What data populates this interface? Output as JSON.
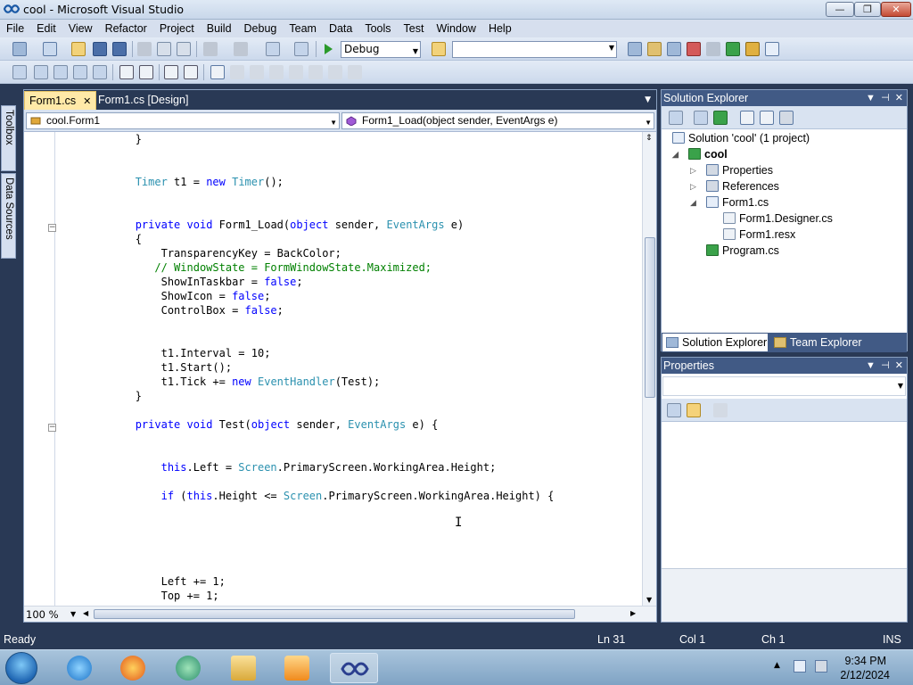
{
  "window": {
    "title": "cool - Microsoft Visual Studio",
    "min": "—",
    "max": "❐",
    "close": "✕"
  },
  "menu": [
    "File",
    "Edit",
    "View",
    "Refactor",
    "Project",
    "Build",
    "Debug",
    "Team",
    "Data",
    "Tools",
    "Test",
    "Window",
    "Help"
  ],
  "toolbar": {
    "configuration": "Debug",
    "platform": ""
  },
  "left_tabs": {
    "toolbox": "Toolbox",
    "data_sources": "Data Sources"
  },
  "editor": {
    "tabs": [
      {
        "label": "Form1.cs",
        "active": true
      },
      {
        "label": "Form1.cs [Design]",
        "active": false
      }
    ],
    "close_glyph": "✕",
    "nav_class": "cool.Form1",
    "nav_member": "Form1_Load(object sender, EventArgs e)",
    "zoom": "100 %",
    "code_lines": [
      {
        "t": "            }",
        "cls": ""
      },
      {
        "t": "",
        "cls": ""
      },
      {
        "t": "",
        "cls": ""
      },
      {
        "t": "            Timer t1 = new Timer();",
        "cls": "timer"
      },
      {
        "t": "",
        "cls": ""
      },
      {
        "t": "",
        "cls": ""
      },
      {
        "t": "            private void Form1_Load(object sender, EventArgs e)",
        "cls": "load"
      },
      {
        "t": "            {",
        "cls": ""
      },
      {
        "t": "                TransparencyKey = BackColor;",
        "cls": ""
      },
      {
        "t": "               // WindowState = FormWindowState.Maximized;",
        "cls": "cm"
      },
      {
        "t": "                ShowInTaskbar = false;",
        "cls": "false"
      },
      {
        "t": "                ShowIcon = false;",
        "cls": "false"
      },
      {
        "t": "                ControlBox = false;",
        "cls": "false"
      },
      {
        "t": "",
        "cls": ""
      },
      {
        "t": "",
        "cls": ""
      },
      {
        "t": "                t1.Interval = 10;",
        "cls": ""
      },
      {
        "t": "                t1.Start();",
        "cls": ""
      },
      {
        "t": "                t1.Tick += new EventHandler(Test);",
        "cls": "tick"
      },
      {
        "t": "            }",
        "cls": ""
      },
      {
        "t": "",
        "cls": ""
      },
      {
        "t": "            private void Test(object sender, EventArgs e) {",
        "cls": "test"
      },
      {
        "t": "",
        "cls": ""
      },
      {
        "t": "",
        "cls": ""
      },
      {
        "t": "                this.Left = Screen.PrimaryScreen.WorkingArea.Height;",
        "cls": "left"
      },
      {
        "t": "",
        "cls": ""
      },
      {
        "t": "                if (this.Height <= Screen.PrimaryScreen.WorkingArea.Height) {",
        "cls": "if"
      },
      {
        "t": "",
        "cls": ""
      },
      {
        "t": "",
        "cls": ""
      },
      {
        "t": "",
        "cls": ""
      },
      {
        "t": "",
        "cls": ""
      },
      {
        "t": "",
        "cls": ""
      },
      {
        "t": "                Left += 1;",
        "cls": ""
      },
      {
        "t": "                Top += 1;",
        "cls": ""
      }
    ]
  },
  "solution_explorer": {
    "title": "Solution Explorer",
    "tree": [
      {
        "label": "Solution 'cool' (1 project)",
        "level": 0,
        "twisty": ""
      },
      {
        "label": "cool",
        "level": 1,
        "twisty": "◢",
        "bold": true
      },
      {
        "label": "Properties",
        "level": 2,
        "twisty": "▷"
      },
      {
        "label": "References",
        "level": 2,
        "twisty": "▷"
      },
      {
        "label": "Form1.cs",
        "level": 2,
        "twisty": "◢"
      },
      {
        "label": "Form1.Designer.cs",
        "level": 3,
        "twisty": ""
      },
      {
        "label": "Form1.resx",
        "level": 3,
        "twisty": ""
      },
      {
        "label": "Program.cs",
        "level": 2,
        "twisty": ""
      }
    ],
    "tab_solution": "Solution Explorer",
    "tab_team": "Team Explorer"
  },
  "properties": {
    "title": "Properties"
  },
  "status": {
    "ready": "Ready",
    "ln": "Ln 31",
    "col": "Col 1",
    "ch": "Ch 1",
    "mode": "INS"
  },
  "taskbar": {
    "time": "9:34 PM",
    "date": "2/12/2024"
  },
  "colors": {
    "keyword": "#0000ff",
    "type": "#2b91af",
    "comment": "#008000",
    "chrome": "#293955"
  }
}
